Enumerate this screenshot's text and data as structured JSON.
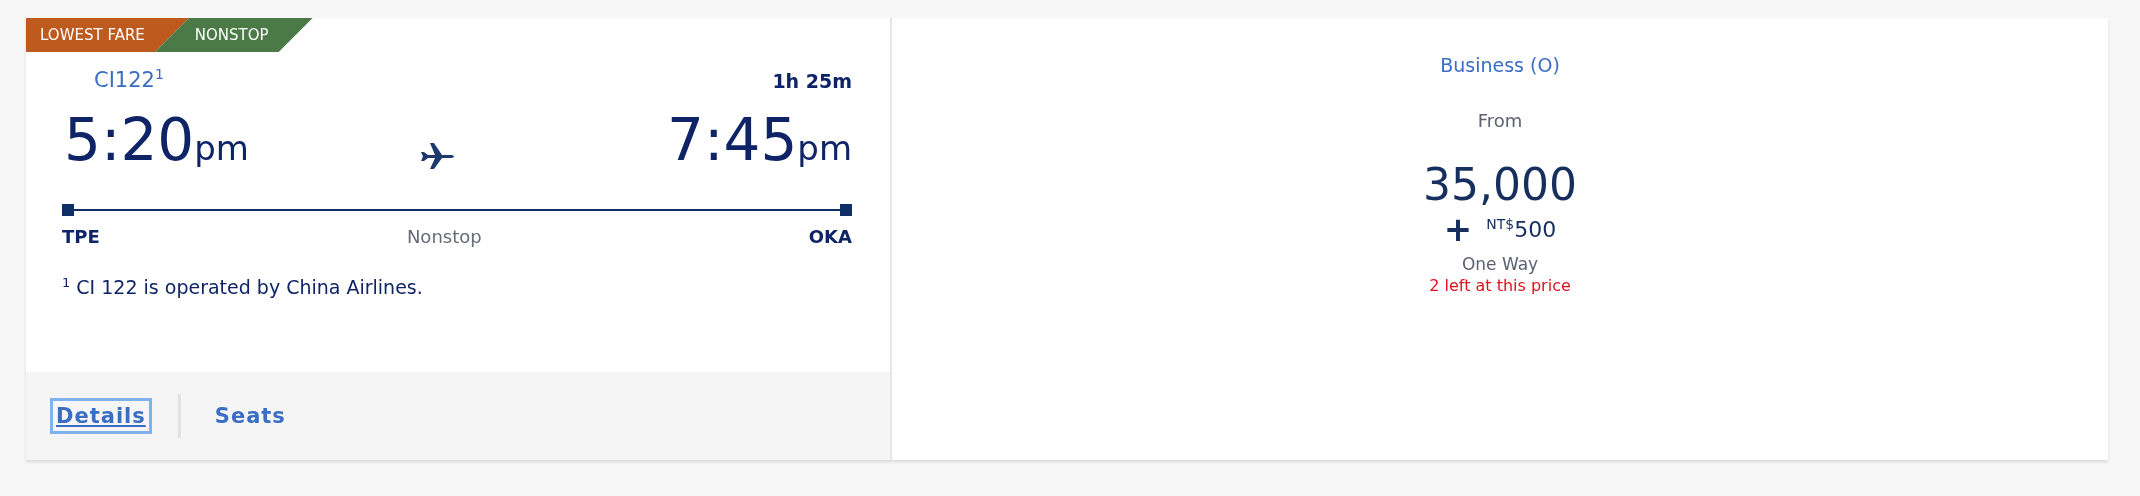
{
  "badges": [
    {
      "label": "LOWEST FARE",
      "color": "#bf5a1f"
    },
    {
      "label": "NONSTOP",
      "color": "#4b7a46"
    }
  ],
  "flight": {
    "number": "CI122$^{1}$",
    "duration": "1h 25m",
    "departure": {
      "time": "5:20",
      "period": "pm",
      "airport": "TPE"
    },
    "arrival": {
      "time": "7:45",
      "period": "pm",
      "airport": "OKA"
    },
    "stops": "Nonstop",
    "footnote": "$^{1}$ CI 122 is operated by China Airlines."
  },
  "links": [
    {
      "label": "Details",
      "focused": true
    },
    {
      "label": "Seats",
      "focused": false
    }
  ],
  "fare": {
    "cabin": "Business (O)",
    "from": "From",
    "points": "35,000",
    "plus": "+",
    "currency": "NT$",
    "cash": "500",
    "trip": "One Way",
    "availability": "2 left at this price"
  }
}
